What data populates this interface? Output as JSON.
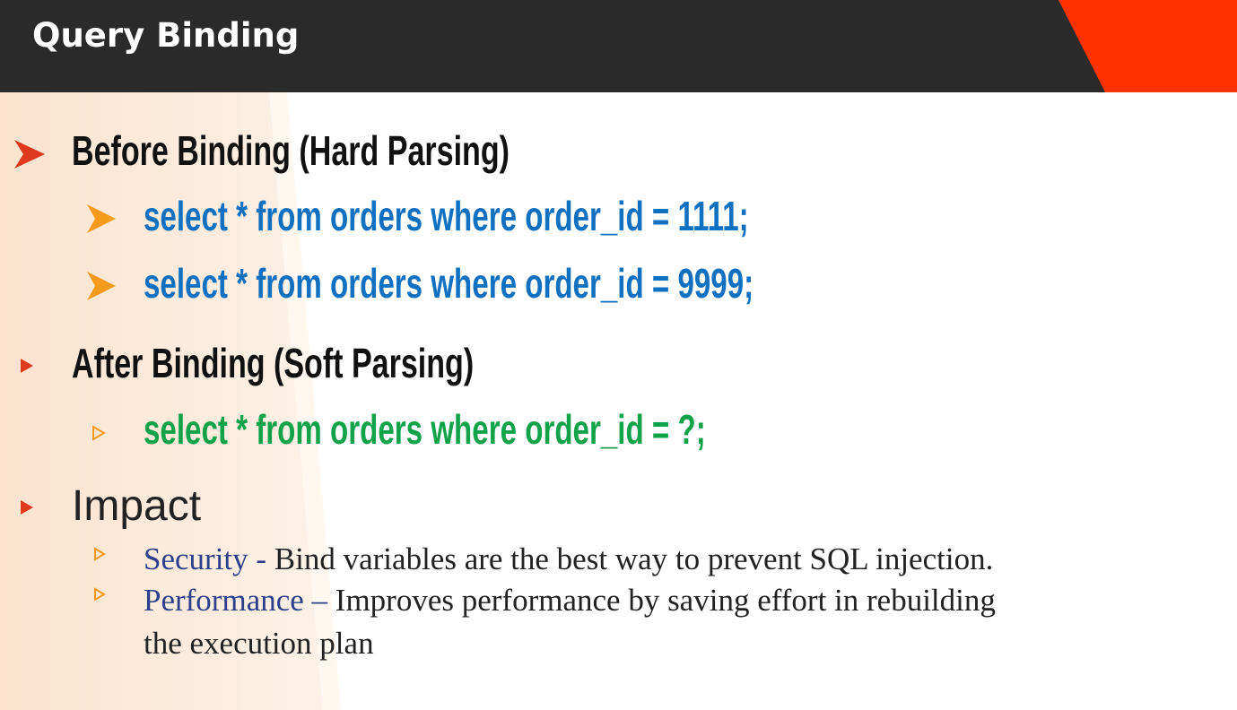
{
  "title": "Query Binding",
  "sections": {
    "before": {
      "heading": "Before Binding (Hard Parsing)",
      "lines": [
        "select * from orders where order_id = 1111;",
        "select * from orders where order_id = 9999;"
      ]
    },
    "after": {
      "heading": "After Binding (Soft Parsing)",
      "lines": [
        "select * from orders where order_id = ?;"
      ]
    },
    "impact": {
      "heading": "Impact",
      "items": [
        {
          "label": "Security -",
          "text": " Bind variables are the best way to prevent SQL injection."
        },
        {
          "label": "Performance –",
          "text": " Improves performance by saving effort in rebuilding",
          "cont": "the execution plan"
        }
      ]
    }
  },
  "colors": {
    "title_bar": "#2a2a2a",
    "accent": "#ff3300",
    "code_blue": "#1170c0",
    "code_green": "#12a24a",
    "bullet_red": "#e03a1e",
    "bullet_orange": "#f59b1c"
  },
  "icons": {
    "level1_bullet": "arrowhead-bullet-icon",
    "level2_bullet": "arrowhead-bullet-icon",
    "small_bullet": "triangle-bullet-icon",
    "outline_bullet": "triangle-outline-bullet-icon"
  }
}
